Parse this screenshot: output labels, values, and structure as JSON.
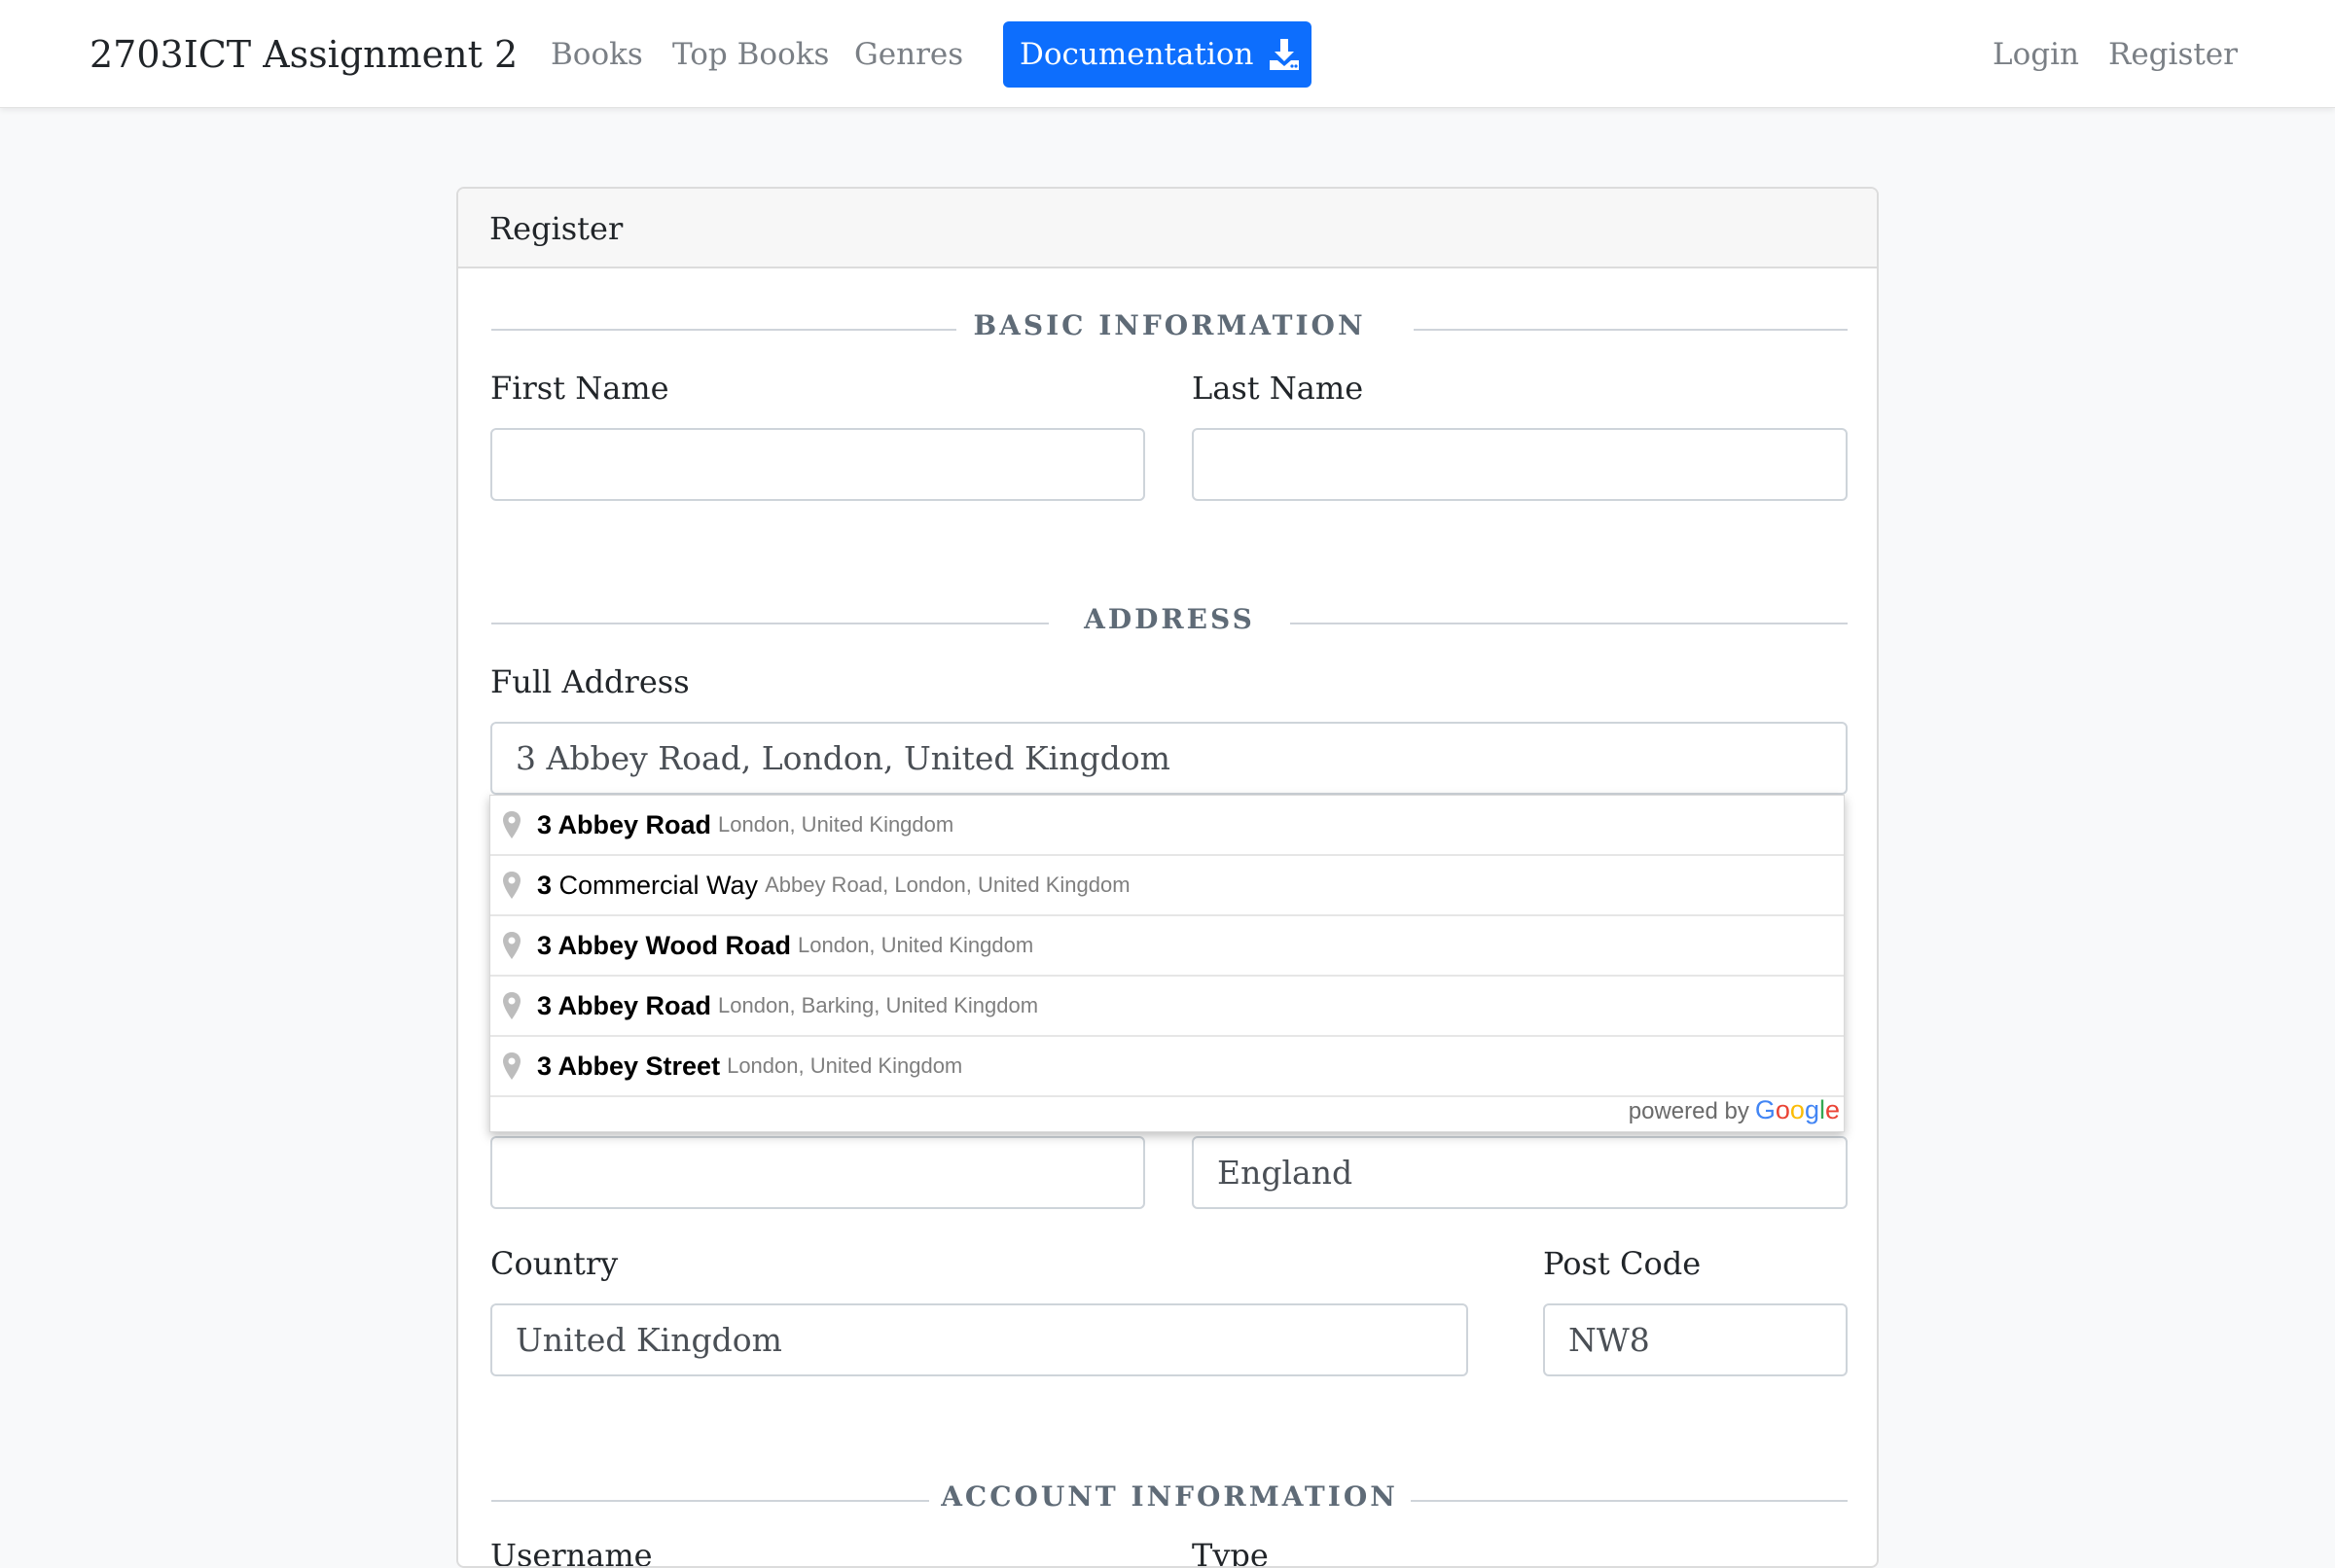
{
  "navbar": {
    "brand": "2703ICT Assignment 2",
    "links": [
      "Books",
      "Top Books",
      "Genres"
    ],
    "documentation_label": "Documentation",
    "login": "Login",
    "register": "Register"
  },
  "card": {
    "title": "Register",
    "sections": {
      "basic": "BASIC INFORMATION",
      "address": "ADDRESS",
      "account": "ACCOUNT INFORMATION"
    },
    "fields": {
      "first_name": {
        "label": "First Name",
        "value": ""
      },
      "last_name": {
        "label": "Last Name",
        "value": ""
      },
      "full_address": {
        "label": "Full Address",
        "value": "3 Abbey Road, London, United Kingdom"
      },
      "city": {
        "value": ""
      },
      "state": {
        "value": "England"
      },
      "country": {
        "label": "Country",
        "value": "United Kingdom"
      },
      "post_code": {
        "label": "Post Code",
        "value": "NW8"
      },
      "username": {
        "label": "Username"
      },
      "type": {
        "label": "Type"
      }
    }
  },
  "autocomplete": {
    "suggestions": [
      {
        "main_bold": "3 Abbey Road",
        "main_rest": "",
        "secondary": "London, United Kingdom"
      },
      {
        "main_bold": "3",
        "main_rest": " Commercial Way",
        "secondary": "Abbey Road, London, United Kingdom"
      },
      {
        "main_bold": "3 Abbey Wood Road",
        "main_rest": "",
        "secondary": "London, United Kingdom"
      },
      {
        "main_bold": "3 Abbey Road",
        "main_rest": "",
        "secondary": "London, Barking, United Kingdom"
      },
      {
        "main_bold": "3 Abbey Street",
        "main_rest": "",
        "secondary": "London, United Kingdom"
      }
    ],
    "powered_by": "powered by",
    "google_letters": [
      "G",
      "o",
      "o",
      "g",
      "l",
      "e"
    ],
    "google_colors": [
      "#4285F4",
      "#EA4335",
      "#FBBC05",
      "#4285F4",
      "#34A853",
      "#EA4335"
    ]
  }
}
